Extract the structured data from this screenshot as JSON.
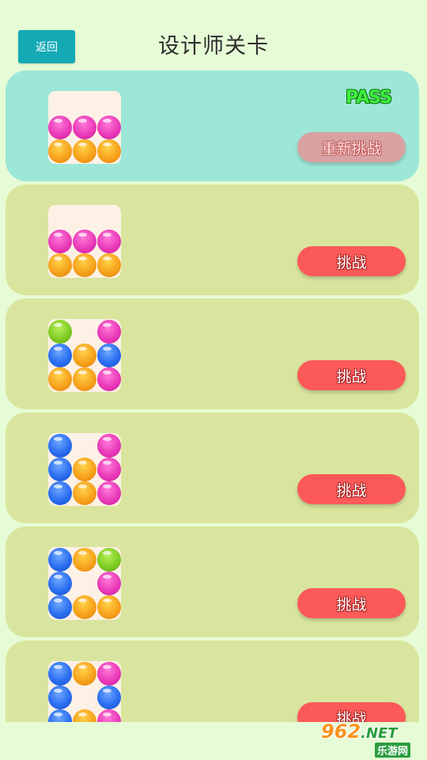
{
  "header": {
    "back_label": "返回",
    "title": "设计师关卡"
  },
  "levels": [
    {
      "status": "passed",
      "badge": "PASS",
      "button_label": "重新挑战",
      "preview": [
        [
          "magenta",
          "magenta",
          "magenta"
        ],
        [
          "orange",
          "orange",
          "orange"
        ]
      ]
    },
    {
      "status": "open",
      "badge": "",
      "button_label": "挑战",
      "preview": [
        [
          "magenta",
          "magenta",
          "magenta"
        ],
        [
          "orange",
          "orange",
          "orange"
        ]
      ]
    },
    {
      "status": "open",
      "badge": "",
      "button_label": "挑战",
      "preview": [
        [
          "green",
          "",
          "magenta"
        ],
        [
          "blue",
          "orange",
          "blue"
        ],
        [
          "orange",
          "orange",
          "magenta"
        ]
      ]
    },
    {
      "status": "open",
      "badge": "",
      "button_label": "挑战",
      "preview": [
        [
          "blue",
          "",
          "magenta"
        ],
        [
          "blue",
          "orange",
          "magenta"
        ],
        [
          "blue",
          "orange",
          "magenta"
        ]
      ]
    },
    {
      "status": "open",
      "badge": "",
      "button_label": "挑战",
      "preview": [
        [
          "blue",
          "orange",
          "green"
        ],
        [
          "blue",
          "",
          "magenta"
        ],
        [
          "blue",
          "orange",
          "orange"
        ]
      ]
    },
    {
      "status": "open",
      "badge": "",
      "button_label": "挑战",
      "preview": [
        [
          "blue",
          "orange",
          "magenta"
        ],
        [
          "blue",
          "",
          "blue"
        ],
        [
          "blue",
          "orange",
          "magenta"
        ]
      ]
    }
  ],
  "watermark": {
    "main": "962",
    "suffix": ".NET",
    "sub": "乐游网"
  }
}
